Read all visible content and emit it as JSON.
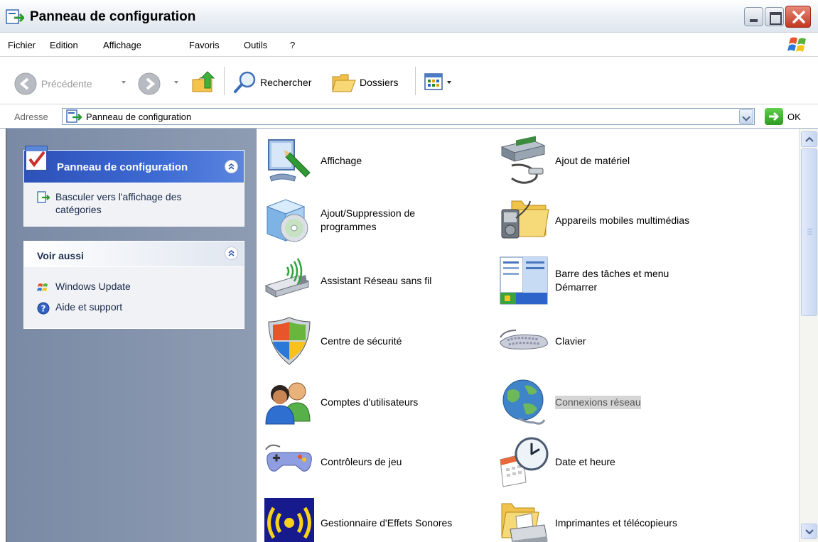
{
  "window": {
    "title": "Panneau de configuration",
    "icon": "control-panel-icon"
  },
  "menu": {
    "items": [
      "Fichier",
      "Edition",
      "Affichage",
      "Favoris",
      "Outils",
      "?"
    ]
  },
  "toolbar": {
    "back_label": "Précédente",
    "search_label": "Rechercher",
    "folders_label": "Dossiers"
  },
  "address": {
    "label": "Adresse",
    "value": "Panneau de configuration",
    "go_label": "OK"
  },
  "taskpane": {
    "panel1_title": "Panneau de configuration",
    "switch_view": "Basculer vers l'affichage des catégories",
    "panel2_title": "Voir aussi",
    "links": [
      "Windows Update",
      "Aide et support"
    ]
  },
  "items": [
    {
      "label": "Affichage",
      "icon": "display-icon"
    },
    {
      "label": "Ajout de matériel",
      "icon": "add-hardware-icon"
    },
    {
      "label": "Ajout/Suppression de programmes",
      "icon": "add-remove-programs-icon"
    },
    {
      "label": "Appareils mobiles multimédias",
      "icon": "portable-media-devices-icon"
    },
    {
      "label": "Assistant Réseau sans fil",
      "icon": "wireless-network-wizard-icon"
    },
    {
      "label": "Barre des tâches et menu Démarrer",
      "icon": "taskbar-start-menu-icon"
    },
    {
      "label": "Centre de sécurité",
      "icon": "security-center-icon"
    },
    {
      "label": "Clavier",
      "icon": "keyboard-icon"
    },
    {
      "label": "Comptes d'utilisateurs",
      "icon": "user-accounts-icon"
    },
    {
      "label": "Connexions réseau",
      "icon": "network-connections-icon",
      "selected": true
    },
    {
      "label": "Contrôleurs de jeu",
      "icon": "game-controllers-icon"
    },
    {
      "label": "Date et heure",
      "icon": "date-time-icon"
    },
    {
      "label": "Gestionnaire d'Effets Sonores",
      "icon": "sound-effects-manager-icon"
    },
    {
      "label": "Imprimantes et télécopieurs",
      "icon": "printers-faxes-icon"
    }
  ]
}
